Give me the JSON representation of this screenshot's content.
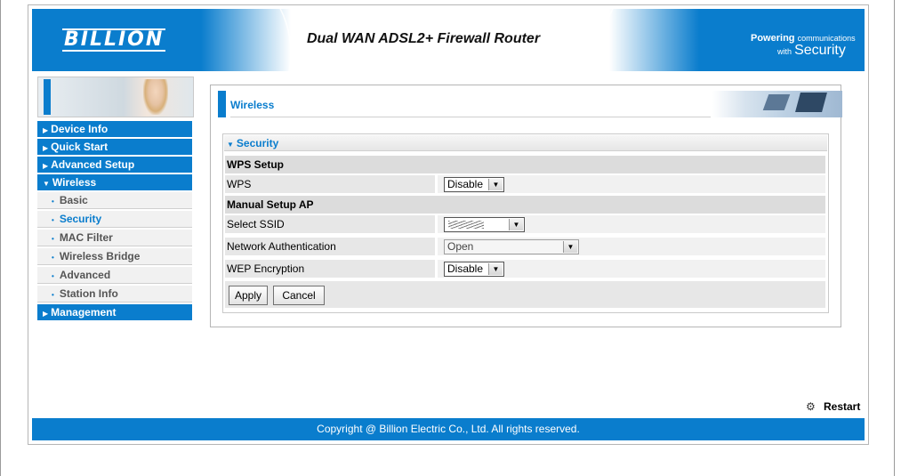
{
  "header": {
    "logo": "BILLION",
    "product_title": "Dual WAN ADSL2+ Firewall Router",
    "tagline_line1": "Powering",
    "tagline_line1_small": "communications",
    "tagline_line2_small": "with",
    "tagline_line2": "Security"
  },
  "sidebar": {
    "items": [
      {
        "label": "Device Info",
        "expanded": false
      },
      {
        "label": "Quick Start",
        "expanded": false
      },
      {
        "label": "Advanced Setup",
        "expanded": false
      },
      {
        "label": "Wireless",
        "expanded": true
      },
      {
        "label": "Management",
        "expanded": false
      }
    ],
    "wireless_sub": [
      {
        "label": "Basic",
        "active": false
      },
      {
        "label": "Security",
        "active": true
      },
      {
        "label": "MAC Filter",
        "active": false
      },
      {
        "label": "Wireless Bridge",
        "active": false
      },
      {
        "label": "Advanced",
        "active": false
      },
      {
        "label": "Station Info",
        "active": false
      }
    ]
  },
  "content": {
    "title": "Wireless",
    "section_title": "Security",
    "wps_setup": "WPS Setup",
    "wps_label": "WPS",
    "wps_value": "Disable",
    "manual_setup": "Manual Setup AP",
    "ssid_label": "Select SSID",
    "auth_label": "Network Authentication",
    "auth_value": "Open",
    "wep_label": "WEP Encryption",
    "wep_value": "Disable",
    "apply": "Apply",
    "cancel": "Cancel"
  },
  "restart": "Restart",
  "footer": "Copyright @ Billion Electric Co., Ltd. All rights reserved.",
  "colors": {
    "accent": "#0a7dcd",
    "row_label_bg": "#e7e7e7",
    "row_value_bg": "#f1f1f1",
    "section_bg": "#dcdcdc"
  },
  "icons": {
    "menu_collapsed": "triangle-right",
    "menu_expanded": "triangle-down",
    "restart": "restart-icon"
  }
}
